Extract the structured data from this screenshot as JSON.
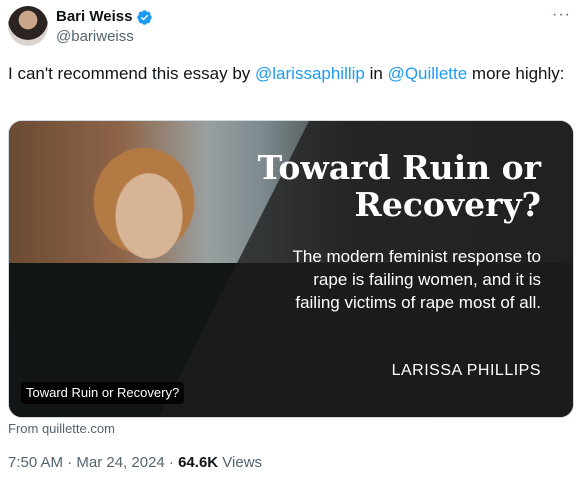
{
  "tweet": {
    "author_name": "Bari Weiss",
    "handle": "@bariweiss",
    "verified_badge": "verified-icon",
    "more_label": "···",
    "text_pre": "I can't recommend this essay by ",
    "mention1": "@larissaphillip",
    "text_mid": " in ",
    "mention2": "@Quillette",
    "text_post": " more highly:"
  },
  "card": {
    "title": "Toward Ruin or Recovery?",
    "subtitle": "The modern feminist response to rape is failing women, and it is failing victims of rape most of all.",
    "author": "LARISSA PHILLIPS",
    "label": "Toward Ruin or Recovery?",
    "source": "From quillette.com"
  },
  "meta": {
    "time_date": "7:50 AM · Mar 24, 2024 · ",
    "views_count": "64.6K",
    "views_label": " Views"
  },
  "colors": {
    "accent": "#1d9bf0",
    "muted": "#536471"
  }
}
